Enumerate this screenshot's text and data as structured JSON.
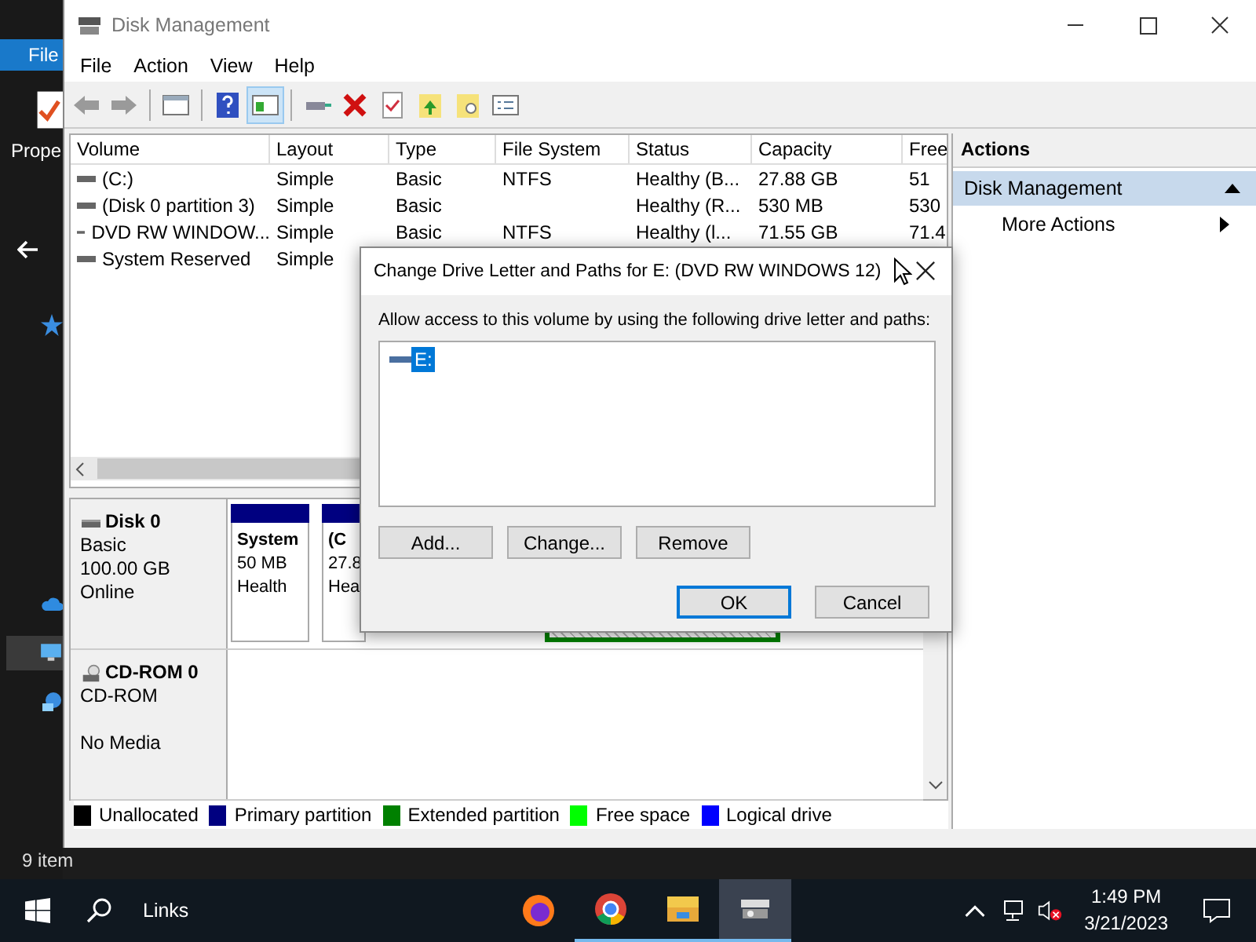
{
  "background_window": {
    "ribbon_tab": "File",
    "ribbon_label": "Prope",
    "status": "9 item"
  },
  "window": {
    "title": "Disk Management"
  },
  "menu": [
    "File",
    "Action",
    "View",
    "Help"
  ],
  "toolbar": [
    {
      "kind": "back",
      "pressed": false
    },
    {
      "kind": "forward",
      "pressed": false
    },
    {
      "kind": "console",
      "pressed": false
    },
    {
      "kind": "help",
      "pressed": false
    },
    {
      "kind": "panel",
      "pressed": true
    },
    {
      "kind": "connect",
      "pressed": false
    },
    {
      "kind": "delete",
      "pressed": false
    },
    {
      "kind": "check",
      "pressed": false
    },
    {
      "kind": "up",
      "pressed": false
    },
    {
      "kind": "find",
      "pressed": false
    },
    {
      "kind": "list",
      "pressed": false
    }
  ],
  "volume_list": {
    "columns": [
      "Volume",
      "Layout",
      "Type",
      "File System",
      "Status",
      "Capacity",
      "Free"
    ],
    "rows": [
      [
        "(C:)",
        "Simple",
        "Basic",
        "NTFS",
        "Healthy (B...",
        "27.88 GB",
        "51"
      ],
      [
        "(Disk 0 partition 3)",
        "Simple",
        "Basic",
        null,
        "Healthy (R...",
        "530 MB",
        "530"
      ],
      [
        "DVD RW WINDOW...",
        "Simple",
        "Basic",
        "NTFS",
        "Healthy (l...",
        "71.55 GB",
        "71.4"
      ],
      [
        "System Reserved",
        "Simple"
      ]
    ]
  },
  "disk_map": {
    "disks": [
      {
        "kind": "disk",
        "name": "Disk 0",
        "type": "Basic",
        "size": "100.00 GB",
        "status": "Online",
        "partitions": [
          {
            "kind": "primary",
            "name": "System",
            "size": "50 MB",
            "status": "Health"
          },
          {
            "kind": "primary",
            "name": "(C",
            "size": "27.8",
            "status": "Hea"
          },
          {
            "kind": "extended"
          }
        ]
      },
      {
        "kind": "cdrom",
        "name": "CD-ROM 0",
        "type": "CD-ROM",
        "status": "No Media"
      }
    ],
    "legend": [
      {
        "label": "Unallocated",
        "color": "#000000"
      },
      {
        "label": "Primary partition",
        "color": "#000080"
      },
      {
        "label": "Extended partition",
        "color": "#008000"
      },
      {
        "label": "Free space",
        "color": "#00ff00"
      },
      {
        "label": "Logical drive",
        "color": "#0000ff"
      }
    ]
  },
  "actions": {
    "title": "Actions",
    "sections": [
      {
        "label": "Disk Management",
        "expanded": true,
        "items": [
          "More Actions"
        ]
      }
    ]
  },
  "dialog": {
    "title": "Change Drive Letter and Paths for E: (DVD RW WINDOWS 12)",
    "prompt": "Allow access to this volume by using the following drive letter and paths:",
    "paths": [
      {
        "label": "E:",
        "selected": true
      }
    ],
    "buttons": [
      {
        "label": "Add...",
        "default": false
      },
      {
        "label": "Change...",
        "default": false
      },
      {
        "label": "Remove",
        "default": false
      }
    ],
    "footer_buttons": [
      {
        "label": "OK",
        "default": true
      },
      {
        "label": "Cancel",
        "default": false
      }
    ]
  },
  "taskbar": {
    "search_label": "Links",
    "apps": [
      {
        "kind": "firefox",
        "open": false,
        "active": false
      },
      {
        "kind": "chrome",
        "open": true,
        "active": false
      },
      {
        "kind": "explorer",
        "open": true,
        "active": false
      },
      {
        "kind": "diskmgmt",
        "open": true,
        "active": true
      }
    ],
    "time": "1:49 PM",
    "date": "3/21/2023"
  }
}
